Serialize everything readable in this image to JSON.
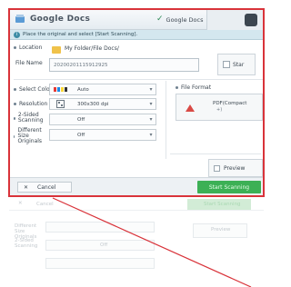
{
  "titlebar": {
    "title": "Google Docs",
    "chip_label": "Google Docs"
  },
  "infobar": {
    "text": "Place the original and select [Start Scanning]."
  },
  "form": {
    "location_label": "Location",
    "location_value": "My Folder/File Docs/",
    "filename_label": "File Name",
    "filename_value": "20200201115912925",
    "star_label": "Star",
    "color_label": "Select Color",
    "color_value": "Auto",
    "resolution_label": "Resolution",
    "resolution_value": "300x300 dpi",
    "twosided_label": "2-Sided Scanning",
    "twosided_value": "Off",
    "diffsize_label": "Different Size Originals",
    "diffsize_value": "Off",
    "fileformat_label": "File Format",
    "fileformat_value": "PDF(Compact",
    "fileformat_sub": "+)",
    "preview_label": "Preview"
  },
  "bottombar": {
    "cancel_label": "Cancel",
    "start_label": "Start Scanning"
  },
  "ghost": {
    "cancel": "Cancel",
    "start": "Start Scanning",
    "diffsize": "Different Size Originals",
    "twosided": "2-Sided Scanning",
    "off": "Off",
    "preview": "Preview"
  },
  "colors": {
    "highlight_border": "#d9333a",
    "start_green": "#3cb055",
    "info_bg": "#d4e7ef"
  }
}
